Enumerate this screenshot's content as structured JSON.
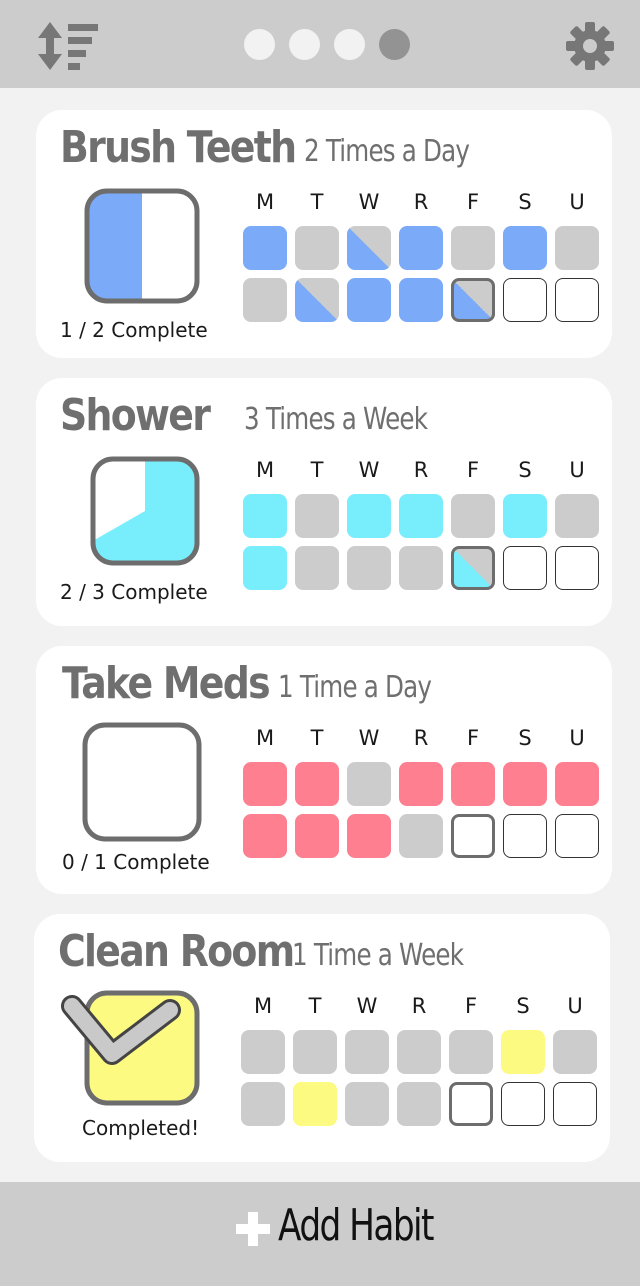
{
  "header": {
    "sort_icon": "sort-arrows-icon",
    "settings_icon": "gear-icon",
    "pages": [
      false,
      false,
      false,
      true
    ]
  },
  "days": [
    "M",
    "T",
    "W",
    "R",
    "F",
    "S",
    "U"
  ],
  "habits": [
    {
      "name": "Brush Teeth",
      "frequency": "2 Times a Day",
      "progress_text": "1 / 2 Complete",
      "progress_fraction": 0.5,
      "progress_style": "half",
      "color": "#7aaaf8",
      "weeks": [
        [
          "full",
          "gray",
          "partial",
          "full",
          "gray",
          "full",
          "gray"
        ],
        [
          "gray",
          "partial",
          "full",
          "full",
          "partial-today",
          "empty",
          "empty"
        ]
      ]
    },
    {
      "name": "Shower",
      "frequency": "3 Times a Week",
      "progress_text": "2 / 3 Complete",
      "progress_fraction": 0.667,
      "progress_style": "pie",
      "color": "#78eefc",
      "weeks": [
        [
          "full",
          "gray",
          "full",
          "full",
          "gray",
          "full",
          "gray"
        ],
        [
          "full",
          "gray",
          "gray",
          "gray",
          "partial-today",
          "empty",
          "empty"
        ]
      ]
    },
    {
      "name": "Take Meds",
      "frequency": "1 Time a Day",
      "progress_text": "0 / 1 Complete",
      "progress_fraction": 0,
      "progress_style": "empty",
      "color": "#fd7f90",
      "weeks": [
        [
          "full",
          "full",
          "gray",
          "full",
          "full",
          "full",
          "full"
        ],
        [
          "full",
          "full",
          "full",
          "gray",
          "empty-today",
          "empty",
          "empty"
        ]
      ]
    },
    {
      "name": "Clean Room",
      "frequency": "1 Time a Week",
      "progress_text": "Completed!",
      "progress_fraction": 1,
      "progress_style": "check",
      "color": "#fdfa82",
      "weeks": [
        [
          "gray",
          "gray",
          "gray",
          "gray",
          "gray",
          "full",
          "gray"
        ],
        [
          "gray",
          "full",
          "gray",
          "gray",
          "empty-today",
          "empty",
          "empty"
        ]
      ]
    }
  ],
  "footer": {
    "add_label": "Add Habit",
    "add_icon": "plus-icon"
  }
}
